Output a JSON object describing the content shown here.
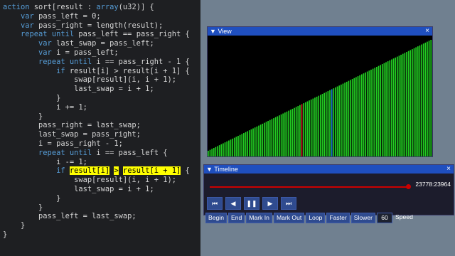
{
  "code_lines": [
    {
      "indent": 0,
      "parts": [
        {
          "k": "kw",
          "t": "action"
        },
        {
          "t": " sort[result : "
        },
        {
          "k": "kw",
          "t": "array"
        },
        {
          "t": "(u32)] {"
        }
      ]
    },
    {
      "indent": 1,
      "parts": [
        {
          "k": "kw",
          "t": "var"
        },
        {
          "t": " pass_left = 0;"
        }
      ]
    },
    {
      "indent": 1,
      "parts": [
        {
          "k": "kw",
          "t": "var"
        },
        {
          "t": " pass_right = length(result);"
        }
      ]
    },
    {
      "indent": 1,
      "parts": [
        {
          "k": "kw",
          "t": "repeat until"
        },
        {
          "t": " pass_left == pass_right {"
        }
      ]
    },
    {
      "indent": 2,
      "parts": [
        {
          "k": "kw",
          "t": "var"
        },
        {
          "t": " last_swap = pass_left;"
        }
      ]
    },
    {
      "indent": 2,
      "parts": [
        {
          "k": "kw",
          "t": "var"
        },
        {
          "t": " i = pass_left;"
        }
      ]
    },
    {
      "indent": 2,
      "parts": [
        {
          "k": "kw",
          "t": "repeat until"
        },
        {
          "t": " i == pass_right - 1 {"
        }
      ]
    },
    {
      "indent": 3,
      "parts": [
        {
          "k": "kw",
          "t": "if"
        },
        {
          "t": " result[i] > result[i + 1] {"
        }
      ]
    },
    {
      "indent": 4,
      "parts": [
        {
          "t": "swap[result](i, i + 1);"
        }
      ]
    },
    {
      "indent": 4,
      "parts": [
        {
          "t": "last_swap = i + 1;"
        }
      ]
    },
    {
      "indent": 3,
      "parts": [
        {
          "t": "}"
        }
      ]
    },
    {
      "indent": 3,
      "parts": [
        {
          "t": "i += 1;"
        }
      ]
    },
    {
      "indent": 2,
      "parts": [
        {
          "t": "}"
        }
      ]
    },
    {
      "indent": 2,
      "parts": [
        {
          "t": "pass_right = last_swap;"
        }
      ]
    },
    {
      "indent": 2,
      "parts": [
        {
          "t": "last_swap = pass_right;"
        }
      ]
    },
    {
      "indent": 2,
      "parts": [
        {
          "t": "i = pass_right - 1;"
        }
      ]
    },
    {
      "indent": 2,
      "parts": [
        {
          "k": "kw",
          "t": "repeat until"
        },
        {
          "t": " i == pass_left {"
        }
      ]
    },
    {
      "indent": 3,
      "parts": [
        {
          "t": "i -= 1;"
        }
      ]
    },
    {
      "indent": 3,
      "parts": [
        {
          "k": "kw",
          "t": "if"
        },
        {
          "t": " "
        },
        {
          "k": "hl",
          "t": "result[i]"
        },
        {
          "t": " "
        },
        {
          "k": "hl",
          "t": ">"
        },
        {
          "t": " "
        },
        {
          "k": "hl",
          "t": "result[i + 1]"
        },
        {
          "t": " {"
        }
      ]
    },
    {
      "indent": 4,
      "parts": [
        {
          "t": "swap[result](i, i + 1);"
        }
      ]
    },
    {
      "indent": 4,
      "parts": [
        {
          "t": "last_swap = i + 1;"
        }
      ]
    },
    {
      "indent": 3,
      "parts": [
        {
          "t": "}"
        }
      ]
    },
    {
      "indent": 2,
      "parts": [
        {
          "t": "}"
        }
      ]
    },
    {
      "indent": 2,
      "parts": [
        {
          "t": "pass_left = last_swap;"
        }
      ]
    },
    {
      "indent": 1,
      "parts": [
        {
          "t": "}"
        }
      ]
    },
    {
      "indent": 0,
      "parts": [
        {
          "t": "}"
        }
      ]
    }
  ],
  "view": {
    "title": "View",
    "close_icon": "×"
  },
  "timeline": {
    "title": "Timeline",
    "close_icon": "×",
    "frame": "23778:23964",
    "progress": 0.9922,
    "controls": [
      {
        "name": "skip-back-icon",
        "glyph": "⏮"
      },
      {
        "name": "step-back-icon",
        "glyph": "◀"
      },
      {
        "name": "pause-icon",
        "glyph": "❚❚"
      },
      {
        "name": "play-icon",
        "glyph": "▶"
      },
      {
        "name": "skip-forward-icon",
        "glyph": "⏭"
      }
    ],
    "actions": [
      "Begin",
      "End",
      "Mark In",
      "Mark Out",
      "Loop",
      "Faster",
      "Slower"
    ],
    "speed_value": "60",
    "speed_label": "Speed"
  },
  "colors": {
    "bar": "#22cc22",
    "compare_left": "#cc2222",
    "compare_right": "#1a7fd0",
    "background": "#708090"
  },
  "bars": {
    "count": 120,
    "red_index": 50,
    "blue_index": 66
  }
}
